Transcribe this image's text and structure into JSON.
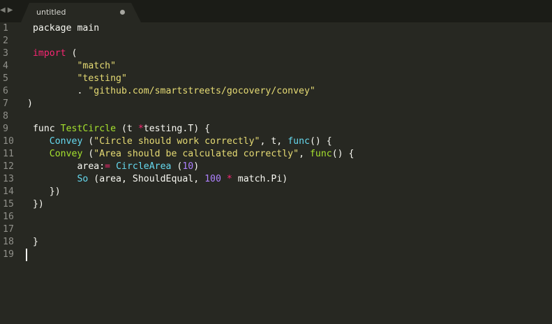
{
  "window": {
    "tab_title": "untitled",
    "nav_back": "◀",
    "nav_forward": "▶"
  },
  "colors": {
    "background": "#272822",
    "tabbar": "#1b1c17",
    "tab": "#272822",
    "keyword": "#f92672",
    "string": "#e6db74",
    "function": "#66d9ef",
    "call": "#a6e22e",
    "number": "#ae81ff",
    "text": "#f8f8f2",
    "gutter": "#90908a"
  },
  "editor": {
    "cursor_line": 19,
    "lines": [
      {
        "n": "1",
        "tokens": [
          [
            "",
            " package main"
          ]
        ]
      },
      {
        "n": "2",
        "tokens": []
      },
      {
        "n": "3",
        "tokens": [
          [
            "",
            " "
          ],
          [
            "kw",
            "import"
          ],
          [
            "",
            " ("
          ]
        ]
      },
      {
        "n": "4",
        "tokens": [
          [
            "",
            "         "
          ],
          [
            "str",
            "\"match\""
          ]
        ]
      },
      {
        "n": "5",
        "tokens": [
          [
            "",
            "         "
          ],
          [
            "str",
            "\"testing\""
          ]
        ]
      },
      {
        "n": "6",
        "tokens": [
          [
            "",
            "         . "
          ],
          [
            "str",
            "\"github.com/smartstreets/gocovery/convey\""
          ]
        ]
      },
      {
        "n": "7",
        "tokens": [
          [
            "",
            ")"
          ]
        ]
      },
      {
        "n": "8",
        "tokens": []
      },
      {
        "n": "9",
        "tokens": [
          [
            "",
            " func "
          ],
          [
            "call",
            "TestCircle"
          ],
          [
            "",
            " (t "
          ],
          [
            "kw",
            "*"
          ],
          [
            "",
            "testing.T) {"
          ]
        ]
      },
      {
        "n": "10",
        "tokens": [
          [
            "",
            "    "
          ],
          [
            "fn",
            "Convey"
          ],
          [
            "",
            " ("
          ],
          [
            "str",
            "\"Circle should work correctly\""
          ],
          [
            "",
            ", t, "
          ],
          [
            "fn",
            "func"
          ],
          [
            "",
            "() {"
          ]
        ]
      },
      {
        "n": "11",
        "tokens": [
          [
            "",
            "    "
          ],
          [
            "call",
            "Convey"
          ],
          [
            "",
            " ("
          ],
          [
            "str",
            "\"Area should be calculated correctly\""
          ],
          [
            "",
            ", "
          ],
          [
            "call",
            "func"
          ],
          [
            "",
            "() {"
          ]
        ]
      },
      {
        "n": "12",
        "tokens": [
          [
            "",
            "         area:"
          ],
          [
            "kw",
            "="
          ],
          [
            "",
            " "
          ],
          [
            "fn",
            "CircleArea"
          ],
          [
            "",
            " ("
          ],
          [
            "num",
            "10"
          ],
          [
            "",
            ")"
          ]
        ]
      },
      {
        "n": "13",
        "tokens": [
          [
            "",
            "         "
          ],
          [
            "fn",
            "So"
          ],
          [
            "",
            " (area, ShouldEqual, "
          ],
          [
            "num",
            "100"
          ],
          [
            "",
            " "
          ],
          [
            "kw",
            "*"
          ],
          [
            "",
            " match.Pi)"
          ]
        ]
      },
      {
        "n": "14",
        "tokens": [
          [
            "",
            "    })"
          ]
        ]
      },
      {
        "n": "15",
        "tokens": [
          [
            "",
            " })"
          ]
        ]
      },
      {
        "n": "16",
        "tokens": []
      },
      {
        "n": "17",
        "tokens": []
      },
      {
        "n": "18",
        "tokens": [
          [
            "",
            " }"
          ]
        ]
      },
      {
        "n": "19",
        "tokens": []
      }
    ]
  }
}
